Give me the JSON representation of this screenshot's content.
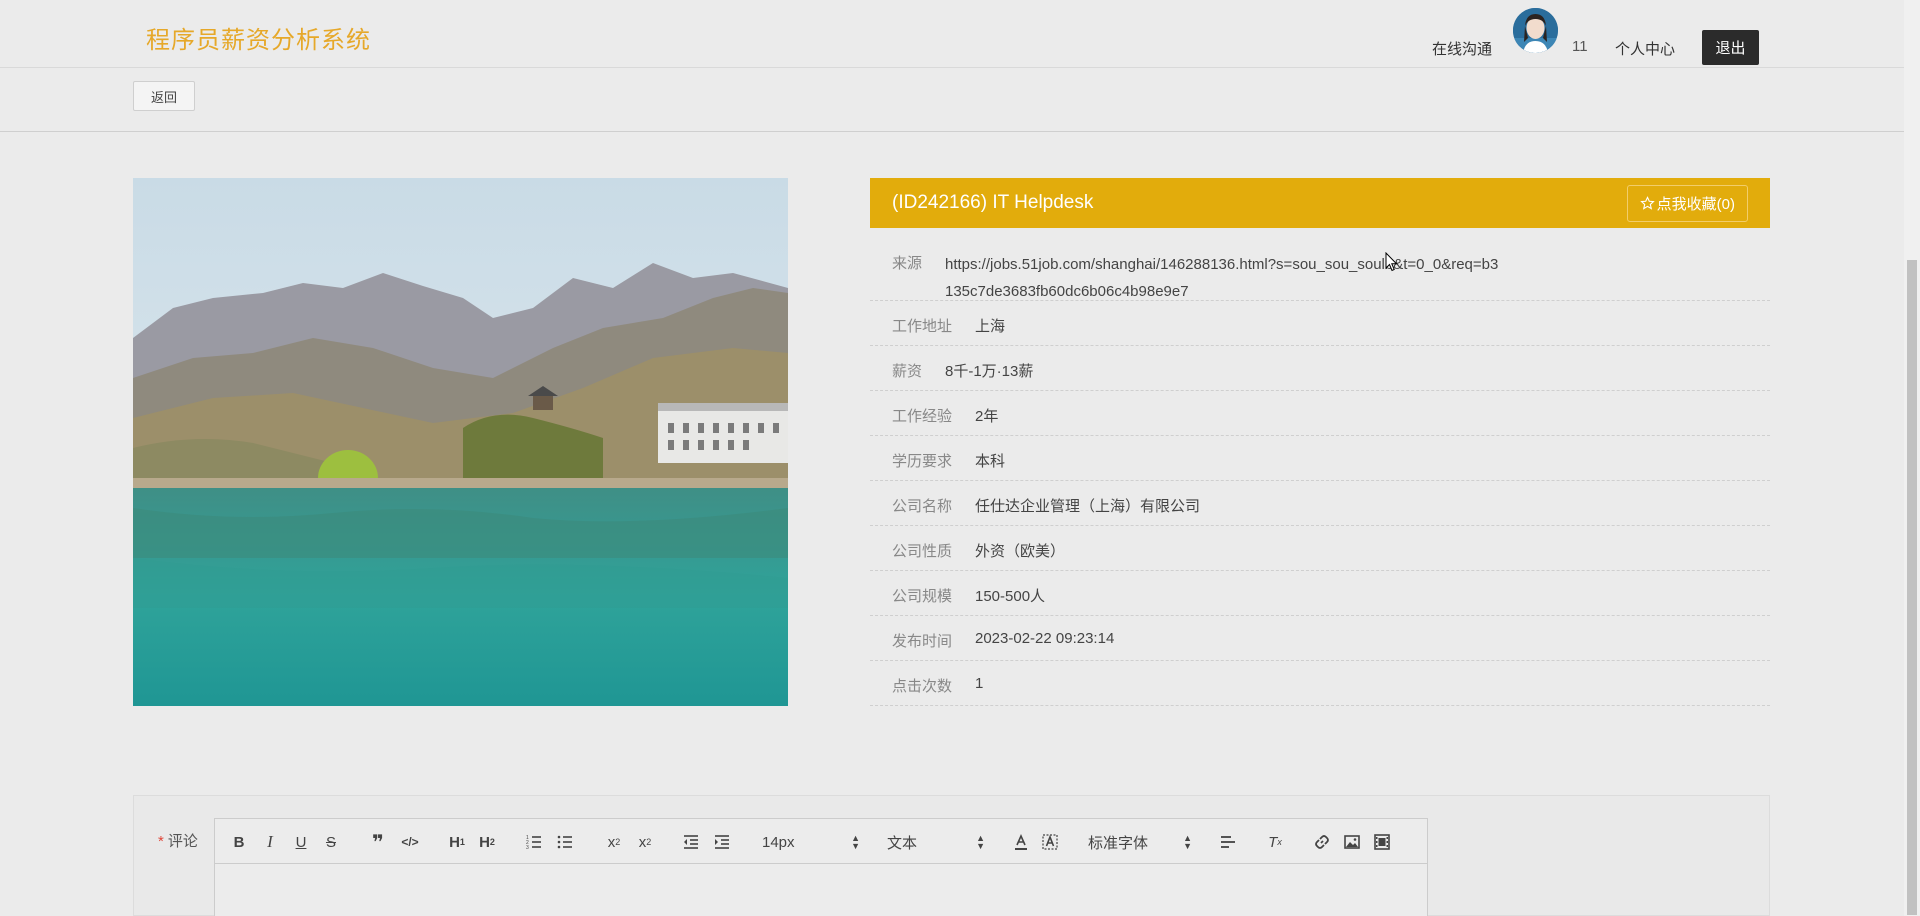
{
  "header": {
    "brand": "程序员薪资分析系统",
    "chat_label": "在线沟通",
    "username": "11",
    "center_label": "个人中心",
    "logout_label": "退出"
  },
  "toolbar_back": {
    "label": "返回"
  },
  "job": {
    "title": "(ID242166) IT Helpdesk",
    "favorite_label": "点我收藏(0)",
    "fields": [
      {
        "key": "来源",
        "value": "https://jobs.51job.com/shanghai/146288136.html?s=sou_sou_soulb&t=0_0&req=b3135c7de3683fb60dc6b06c4b98e9e7"
      },
      {
        "key": "工作地址",
        "value": "上海"
      },
      {
        "key": "薪资",
        "value": "8千-1万·13薪"
      },
      {
        "key": "工作经验",
        "value": "2年"
      },
      {
        "key": "学历要求",
        "value": "本科"
      },
      {
        "key": "公司名称",
        "value": "任仕达企业管理（上海）有限公司"
      },
      {
        "key": "公司性质",
        "value": "外资（欧美）"
      },
      {
        "key": "公司规模",
        "value": "150-500人"
      },
      {
        "key": "发布时间",
        "value": "2023-02-22 09:23:14"
      },
      {
        "key": "点击次数",
        "value": "1"
      }
    ]
  },
  "comment": {
    "required_mark": "*",
    "label": "评论",
    "font_size": "14px",
    "text_style": "文本",
    "font_family": "标准字体"
  },
  "colors": {
    "accent": "#e2ac0c",
    "brand": "#e6a829",
    "logout_bg": "#2b2b2b"
  }
}
